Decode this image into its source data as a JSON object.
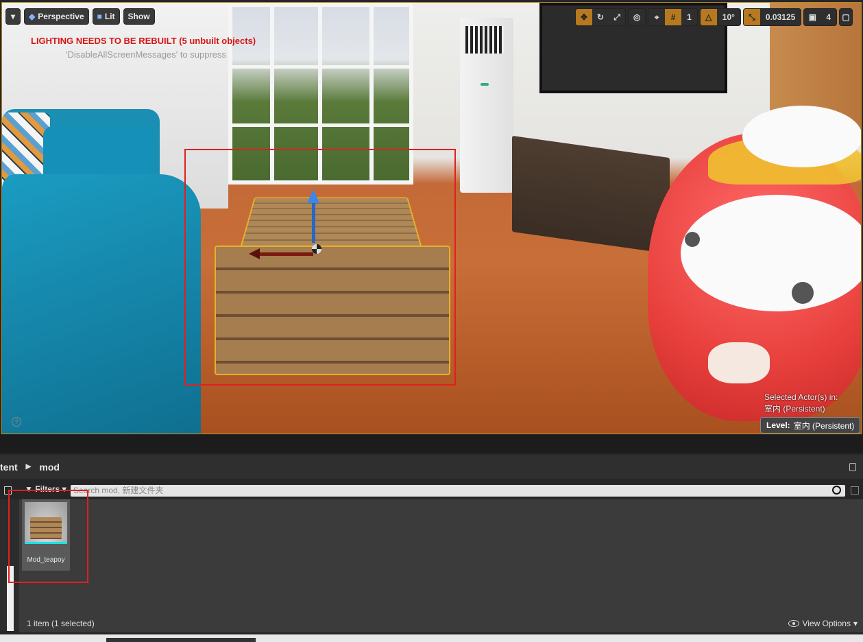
{
  "viewport": {
    "menu_icon": "chevron-down-icon",
    "view_mode_label": "Perspective",
    "lit_label": "Lit",
    "show_label": "Show",
    "grid_snap_value": "1",
    "rotation_snap_value": "10°",
    "scale_snap_value": "0.03125",
    "camera_speed_value": "4",
    "warning_message": "LIGHTING NEEDS TO BE REBUILT (5 unbuilt objects)",
    "suppress_message": "'DisableAllScreenMessages' to suppress",
    "selected_actors_line1": "Selected Actor(s) in:",
    "selected_actors_line2": "室内 (Persistent)",
    "level_label": "Level:",
    "level_value": "室内 (Persistent)",
    "accent_color": "#b7791f",
    "selection_color": "#e02020"
  },
  "content_browser": {
    "breadcrumb": [
      "tent",
      "mod"
    ],
    "filters_label": "Filters",
    "search_placeholder": "Search mod, 新建文件夹",
    "assets": [
      {
        "name": "Mod_teapoy",
        "selected": true
      }
    ],
    "status_text": "1 item (1 selected)",
    "view_options_label": "View Options"
  }
}
